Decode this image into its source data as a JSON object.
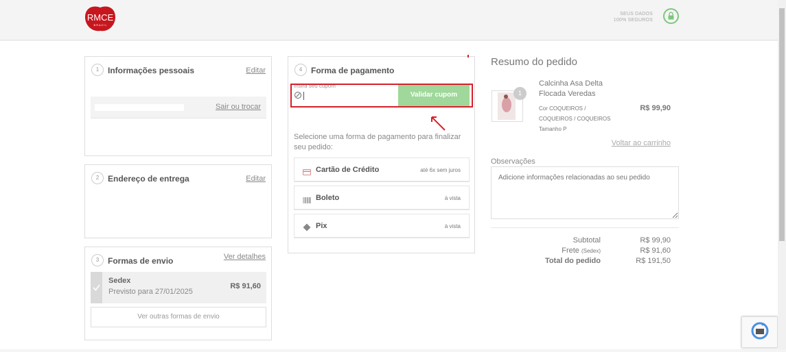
{
  "header": {
    "logo_text": "RMCE",
    "logo_sub": "B R A Z I L",
    "secure_line1": "SEUS DADOS",
    "secure_line2": "100% SEGUROS",
    "lock_icon": "lock-icon"
  },
  "personal": {
    "step": "1",
    "title": "Informações pessoais",
    "edit": "Editar",
    "logout": "Sair ou trocar"
  },
  "address": {
    "step": "2",
    "title": "Endereço de entrega",
    "edit": "Editar"
  },
  "shipping": {
    "step": "3",
    "title": "Formas de envio",
    "details": "Ver detalhes",
    "option_name": "Sedex",
    "option_eta": "Previsto para 27/01/2025",
    "option_price": "R$ 91,60",
    "other_options": "Ver outras formas de envio"
  },
  "payment": {
    "step": "4",
    "title": "Forma de pagamento",
    "coupon_label": "Insira seu cupom",
    "validate_button": "Validar cupom",
    "instruction": "Selecione uma forma de pagamento para finalizar seu pedido:",
    "options": [
      {
        "name": "Cartão de Crédito",
        "cond": "até 6x sem juros",
        "icon": "credit-card-icon"
      },
      {
        "name": "Boleto",
        "cond": "à vista",
        "icon": "barcode-icon"
      },
      {
        "name": "Pix",
        "cond": "à vista",
        "icon": "pix-icon"
      }
    ]
  },
  "summary": {
    "title": "Resumo do pedido",
    "product_name_1": "Calcinha Asa Delta",
    "product_name_2": "Flocada Veredas",
    "qty": "1",
    "color_1": "Cor COQUEIROS /",
    "color_2": "COQUEIROS / COQUEIROS",
    "size": "Tamanho P",
    "price": "R$ 99,90",
    "back_to_cart": "Voltar ao carrinho",
    "notes_label": "Observações",
    "notes_placeholder": "Adicione informações relacionadas ao seu pedido",
    "subtotal_label": "Subtotal",
    "subtotal_value": "R$ 99,90",
    "shipping_label": "Frete",
    "shipping_tag": "(Sedex)",
    "shipping_value": "R$ 91,60",
    "total_label": "Total do pedido",
    "total_value": "R$ 191,50"
  },
  "colors": {
    "brand_red": "#c7161e",
    "validate_green": "#9fd89a",
    "highlight_red": "#d61f2a"
  }
}
